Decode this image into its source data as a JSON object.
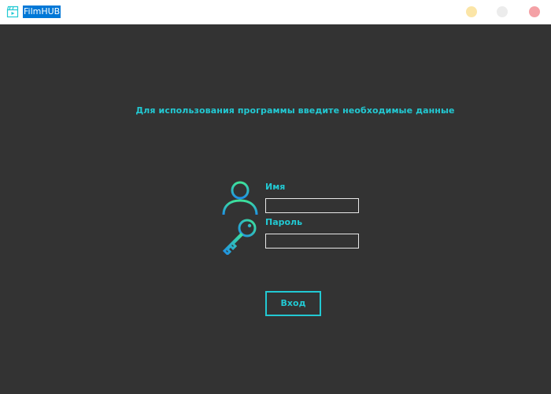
{
  "window": {
    "title": "FilmHUB",
    "icon": "film-clapper-icon",
    "controls": [
      "minimize-button",
      "maximize-button",
      "close-button"
    ],
    "control_colors": {
      "minimize": "#fbe5a7",
      "maximize": "#ececec",
      "close": "#f4a1a6"
    }
  },
  "login": {
    "prompt": "Для использования программы введите необходимые данные",
    "name_label": "Имя",
    "name_value": "",
    "password_label": "Пароль",
    "password_value": "",
    "submit_label": "Вход"
  },
  "theme": {
    "accent": "#22c9d3",
    "background": "#333333",
    "icon_gradient_top": "#3ee39a",
    "icon_gradient_bottom": "#1f8fe6"
  }
}
